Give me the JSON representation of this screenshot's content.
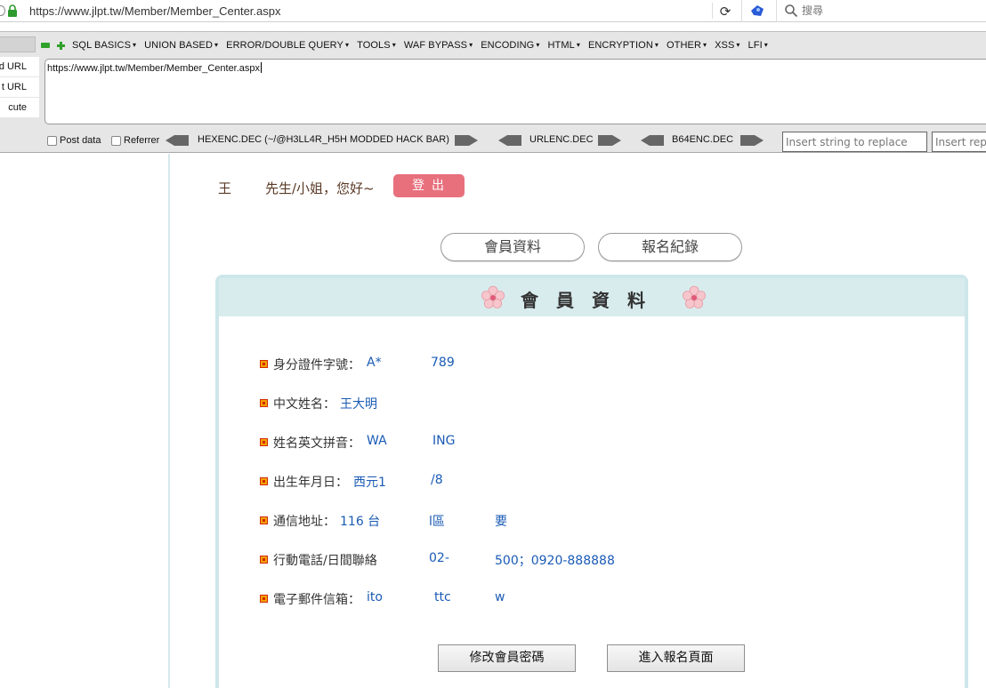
{
  "browser": {
    "url": "https://www.jlpt.tw/Member/Member_Center.aspx",
    "search_placeholder": "搜尋"
  },
  "hackbar": {
    "menu": [
      "SQL BASICS",
      "UNION BASED",
      "ERROR/DOUBLE QUERY",
      "TOOLS",
      "WAF BYPASS",
      "ENCODING",
      "HTML",
      "ENCRYPTION",
      "OTHER",
      "XSS",
      "LFI"
    ],
    "side_buttons": [
      "d URL",
      "t URL",
      "cute"
    ],
    "url_value": "https://www.jlpt.tw/Member/Member_Center.aspx",
    "post_data_label": "Post data",
    "referrer_label": "Referrer",
    "encoders": [
      "HEXENC.DEC (~/@H3LL4R_H5H MODDED HACK BAR)",
      "URLENC.DEC",
      "B64ENC.DEC"
    ],
    "replace_placeholder": "Insert string to replace",
    "replace_with_placeholder": "Insert repl"
  },
  "page": {
    "greeting_name": "王",
    "greeting_text": "先生/小姐，您好~",
    "logout_label": "登出",
    "tabs": [
      "會員資料",
      "報名紀錄"
    ],
    "card_title": "會員資料",
    "fields": [
      {
        "label": "身分證件字號：",
        "value_a": "A*",
        "value_b": "789"
      },
      {
        "label": "中文姓名：",
        "value_a": "王大明",
        "value_b": ""
      },
      {
        "label": "姓名英文拼音：",
        "value_a": "WA",
        "value_b": "ING"
      },
      {
        "label": "出生年月日：",
        "value_a": "西元1",
        "value_b": "/8"
      },
      {
        "label": "通信地址：",
        "value_a": "116 台",
        "value_b": "l區",
        "value_c": "要"
      },
      {
        "label": "行動電話/日間聯絡",
        "value_a": "",
        "value_b": "02-",
        "value_c": "500；0920-888888"
      },
      {
        "label": "電子郵件信箱：",
        "value_a": "ito",
        "value_b": "ttc",
        "value_c": "w"
      }
    ],
    "change_password_label": "修改會員密碼",
    "enter_registration_label": "進入報名頁面"
  },
  "colors": {
    "logout": "#e8707d",
    "card_border": "#cde6ea",
    "value_text": "#1a5bb5",
    "greeting_text": "#5a3a26"
  }
}
